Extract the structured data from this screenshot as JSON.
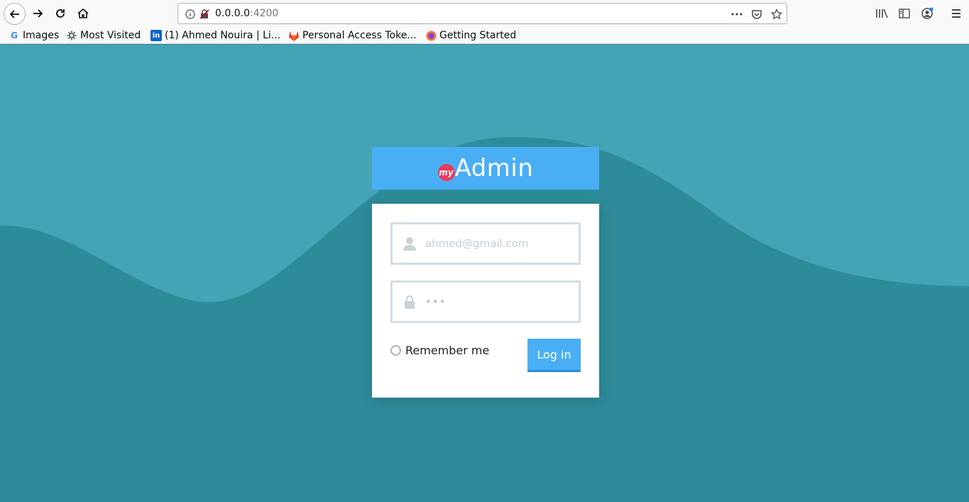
{
  "browser": {
    "url_host": "0.0.0.0",
    "url_port": ":4200",
    "bookmarks": [
      {
        "label": "Images",
        "icon": "google-icon"
      },
      {
        "label": "Most Visited",
        "icon": "gear-icon"
      },
      {
        "label": "(1) Ahmed Nouira | Li...",
        "icon": "linkedin-icon"
      },
      {
        "label": "Personal Access Toke...",
        "icon": "gitlab-icon"
      },
      {
        "label": "Getting Started",
        "icon": "firefox-icon"
      }
    ]
  },
  "brand": {
    "prefix": "my",
    "name": "Admin"
  },
  "login": {
    "email_placeholder": "ahmed@gmail.com",
    "password_value": "•••",
    "remember_label": "Remember me",
    "submit_label": "Log in"
  },
  "colors": {
    "background_light": "#45a3b6",
    "background_dark": "#2e8c9a",
    "accent": "#4aaef5",
    "brand_badge": "#ea3c5c"
  }
}
